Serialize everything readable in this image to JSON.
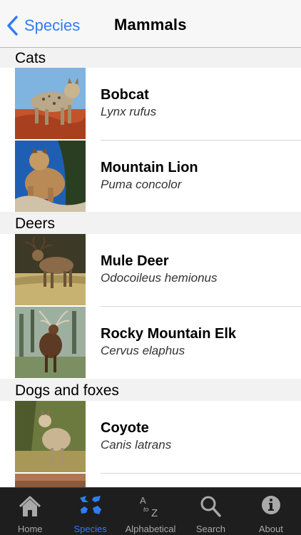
{
  "nav": {
    "back_label": "Species",
    "title": "Mammals"
  },
  "sections": [
    {
      "title": "Cats",
      "items": [
        {
          "name": "Bobcat",
          "scientific": "Lynx rufus"
        },
        {
          "name": "Mountain Lion",
          "scientific": "Puma concolor"
        }
      ]
    },
    {
      "title": "Deers",
      "items": [
        {
          "name": "Mule Deer",
          "scientific": "Odocoileus hemionus"
        },
        {
          "name": "Rocky Mountain Elk",
          "scientific": "Cervus elaphus"
        }
      ]
    },
    {
      "title": "Dogs and foxes",
      "items": [
        {
          "name": "Coyote",
          "scientific": "Canis latrans"
        }
      ]
    }
  ],
  "tabs": [
    {
      "label": "Home",
      "icon": "home-icon",
      "active": false
    },
    {
      "label": "Species",
      "icon": "paw-prints-icon",
      "active": true
    },
    {
      "label": "Alphabetical",
      "icon": "a-to-z-icon",
      "active": false
    },
    {
      "label": "Search",
      "icon": "search-icon",
      "active": false
    },
    {
      "label": "About",
      "icon": "info-icon",
      "active": false
    }
  ],
  "colors": {
    "accent": "#2f7cf6",
    "tabbar_bg": "#1e1e1e",
    "tab_inactive": "#a9a9a9",
    "section_bg": "#f2f2f2"
  }
}
